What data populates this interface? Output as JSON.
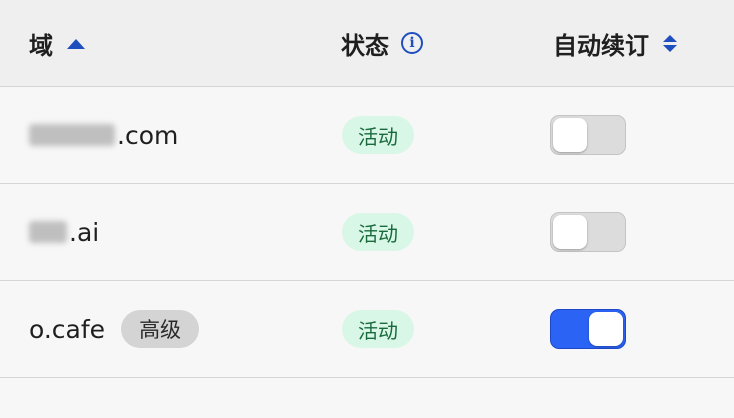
{
  "header": {
    "domain_label": "域",
    "status_label": "状态",
    "renew_label": "自动续订"
  },
  "rows": [
    {
      "domain_suffix": ".com",
      "status": "活动",
      "auto_renew": false,
      "tag": ""
    },
    {
      "domain_suffix": ".ai",
      "status": "活动",
      "auto_renew": false,
      "tag": ""
    },
    {
      "domain_suffix": "o.cafe",
      "status": "活动",
      "auto_renew": true,
      "tag": "高级"
    }
  ],
  "colors": {
    "accent": "#2b63f5",
    "status_bg": "#d9f7e6",
    "status_text": "#1a6a3e"
  },
  "icons": {
    "sort_asc": "sort-ascending-icon",
    "info": "info-icon",
    "sort_both": "sort-icon"
  }
}
